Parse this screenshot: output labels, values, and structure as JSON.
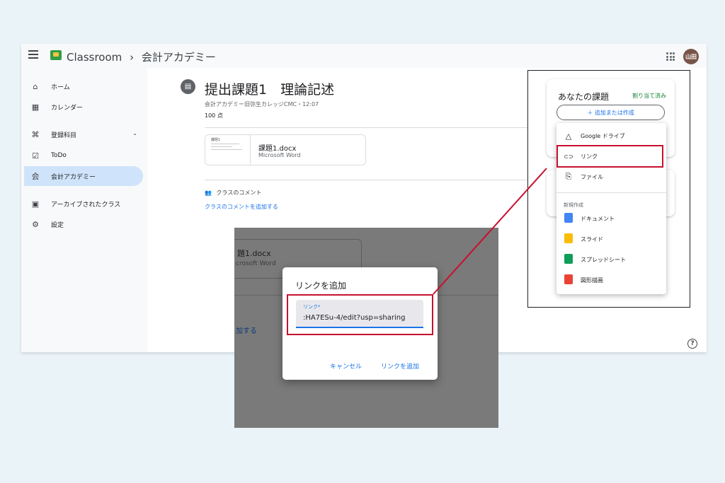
{
  "topbar": {
    "app_name": "Classroom",
    "crumb_sep": "›",
    "class_name": "会計アカデミー",
    "avatar_text": "山田"
  },
  "sidebar": {
    "items": [
      {
        "icon": "⌂",
        "label": "ホーム"
      },
      {
        "icon": "▦",
        "label": "カレンダー"
      },
      {
        "icon": "⌘",
        "label": "登録科目"
      },
      {
        "icon": "☑",
        "label": "ToDo"
      },
      {
        "icon": "会",
        "label": "会計アカデミー"
      },
      {
        "icon": "▣",
        "label": "アーカイブされたクラス"
      },
      {
        "icon": "⚙",
        "label": "設定"
      }
    ],
    "chevron": "⌄"
  },
  "main": {
    "icon": "▤",
    "title": "提出課題1　理論記述",
    "subtitle": "会計アカデミー旧弥生カレッジCMC・12:07",
    "points": "100 点",
    "kebab": "⋮",
    "attachment": {
      "thumb_label": "課題1",
      "name": "課題1.docx",
      "type": "Microsoft Word"
    },
    "comments_header": "クラスのコメント",
    "comments_icon": "👥",
    "add_comment": "クラスのコメントを追加する",
    "help": "?"
  },
  "your_work": {
    "title": "あなたの課題",
    "status": "割り当て済み",
    "add_button": "＋ 追加または作成",
    "menu": {
      "items": [
        {
          "icon": "△",
          "label": "Google ドライブ"
        },
        {
          "icon": "⊂⊃",
          "label": "リンク"
        },
        {
          "icon": "⎘",
          "label": "ファイル"
        }
      ],
      "section_label": "新規作成",
      "create": [
        {
          "label": "ドキュメント"
        },
        {
          "label": "スライド"
        },
        {
          "label": "スプレッドシート"
        },
        {
          "label": "図形描画"
        }
      ]
    }
  },
  "overlay_bg": {
    "name": "題1.docx",
    "type": "crosoft Word",
    "link": "加する"
  },
  "dialog": {
    "title": "リンクを追加",
    "field_label": "リンク*",
    "field_value": ":HA7ESu-4/edit?usp=sharing",
    "cancel": "キャンセル",
    "add": "リンクを追加"
  },
  "colors": {
    "highlight": "#c8102e",
    "accent": "#1a73e8",
    "active_nav": "#cfe4fa"
  }
}
